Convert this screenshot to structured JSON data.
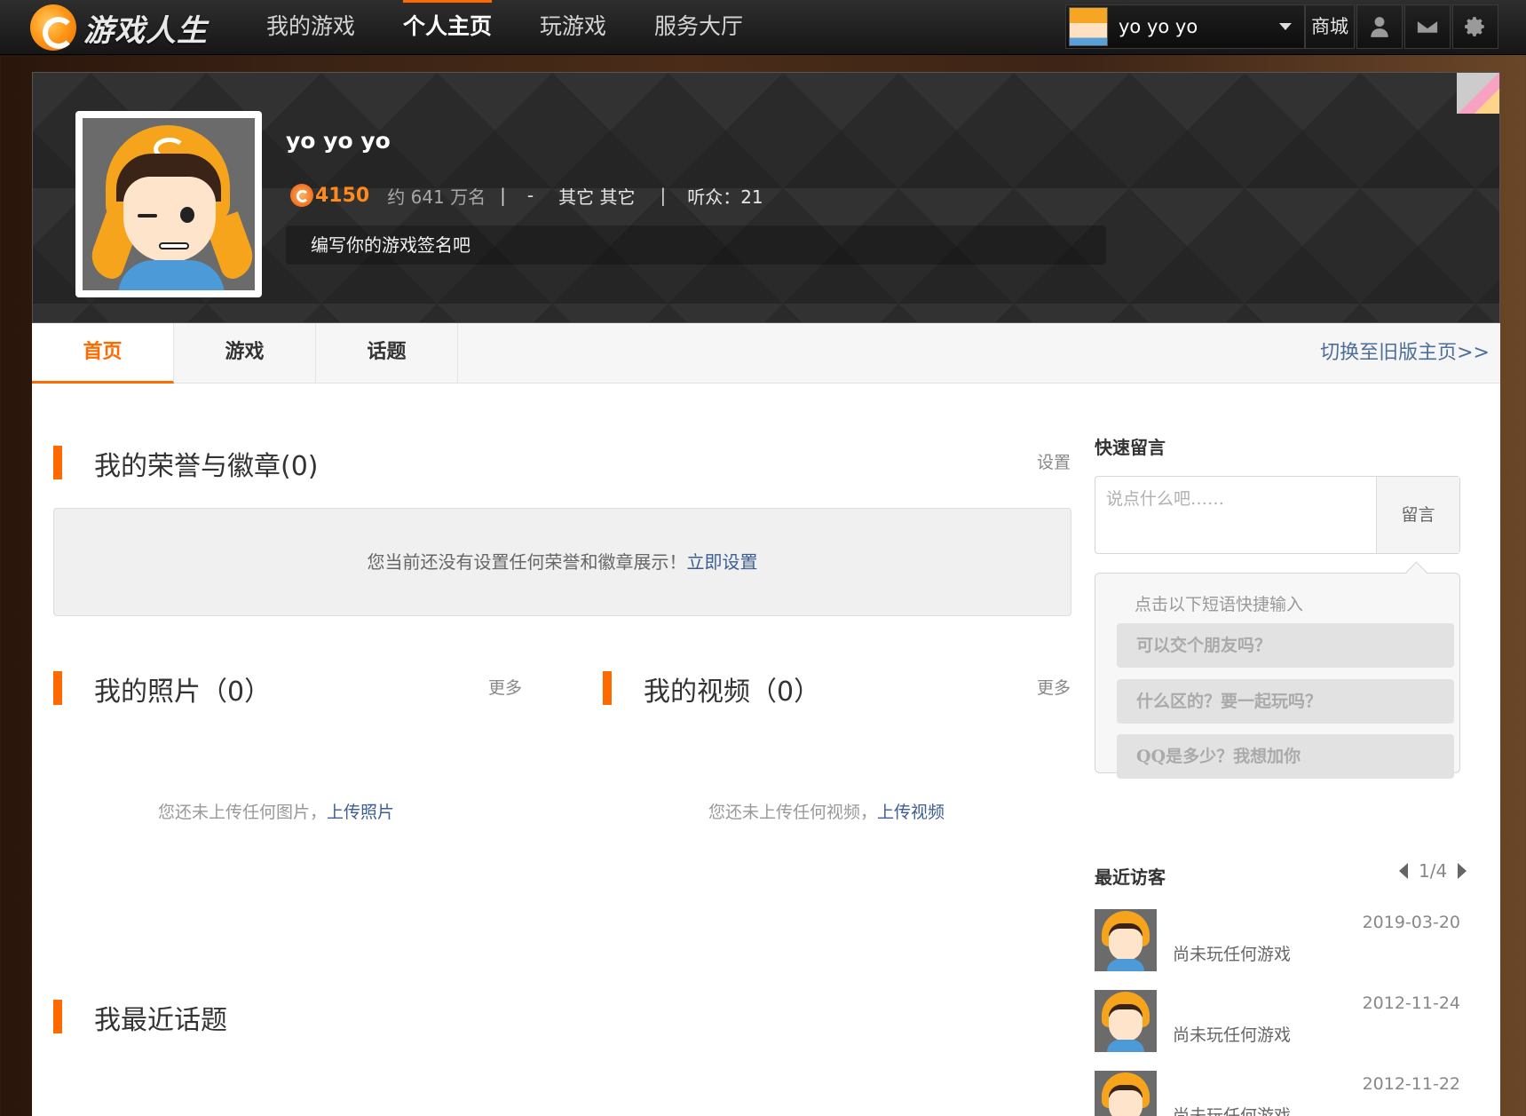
{
  "topbar": {
    "logo_text": "游戏人生",
    "nav": [
      {
        "label": "我的游戏",
        "active": false
      },
      {
        "label": "个人主页",
        "active": true
      },
      {
        "label": "玩游戏",
        "active": false
      },
      {
        "label": "服务大厅",
        "active": false
      }
    ],
    "username": "yo yo yo",
    "shop_label": "商城",
    "icons": [
      "user-icon",
      "mail-icon",
      "gear-icon"
    ]
  },
  "profile": {
    "name": "yo yo yo",
    "score": "4150",
    "rank": "约 641 万名",
    "sep1": "|",
    "dash": "-",
    "region": "其它 其它",
    "sep2": "|",
    "listeners": "听众：21",
    "signature": "编写你的游戏签名吧"
  },
  "tabs": [
    {
      "label": "首页",
      "active": true
    },
    {
      "label": "游戏",
      "active": false
    },
    {
      "label": "话题",
      "active": false
    }
  ],
  "switch_link": "切换至旧版主页>>",
  "honor": {
    "title": "我的荣誉与徽章(0)",
    "settings": "设置",
    "empty_text": "您当前还没有设置任何荣誉和徽章展示！",
    "empty_link": "立即设置"
  },
  "photos": {
    "title": "我的照片（0）",
    "more": "更多",
    "empty_text": "您还未上传任何图片，",
    "empty_link": "上传照片"
  },
  "videos": {
    "title": "我的视频（0）",
    "more": "更多",
    "empty_text": "您还未上传任何视频，",
    "empty_link": "上传视频"
  },
  "topics": {
    "title": "我最近话题"
  },
  "quick_message": {
    "title": "快速留言",
    "placeholder": "说点什么吧……",
    "button": "留言",
    "hint": "点击以下短语快捷输入",
    "phrases": [
      "可以交个朋友吗？",
      "什么区的？要一起玩吗？",
      "QQ是多少？我想加你"
    ]
  },
  "visitors": {
    "title": "最近访客",
    "page": "1/4",
    "items": [
      {
        "date": "2019-03-20",
        "status": "尚未玩任何游戏"
      },
      {
        "date": "2012-11-24",
        "status": "尚未玩任何游戏"
      },
      {
        "date": "2012-11-22",
        "status": "尚未玩任何游戏"
      }
    ]
  },
  "colors": {
    "accent": "#ff6a00",
    "link": "#3d5e93",
    "topbar": "#1e1e1e"
  }
}
